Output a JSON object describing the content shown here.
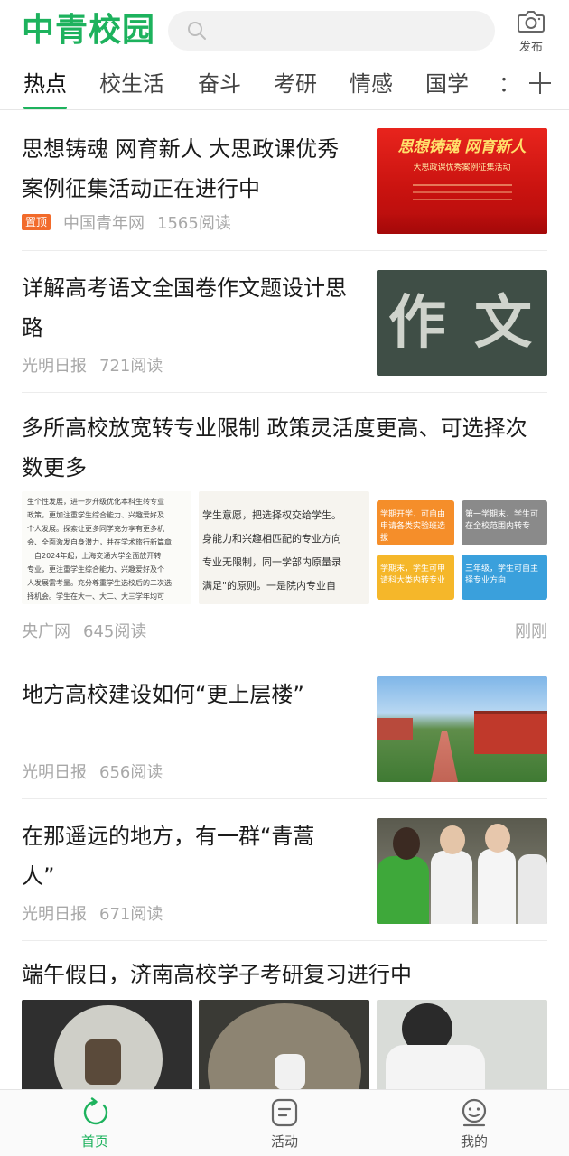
{
  "header": {
    "logo": "中青校园",
    "search_placeholder": "",
    "publish_label": "发布"
  },
  "tabs": [
    {
      "label": "热点",
      "active": true
    },
    {
      "label": "校生活"
    },
    {
      "label": "奋斗"
    },
    {
      "label": "考研"
    },
    {
      "label": "情感"
    },
    {
      "label": "国学"
    }
  ],
  "tab_more": "：",
  "articles": [
    {
      "title": "思想铸魂 网育新人 大思政课优秀案例征集活动正在进行中",
      "badge": "置顶",
      "source": "中国青年网",
      "reads": "1565阅读",
      "image_text": {
        "line1": "思想铸魂  网育新人",
        "line2": "大思政课优秀案例征集活动"
      }
    },
    {
      "title": "详解高考语文全国卷作文题设计思路",
      "source": "光明日报",
      "reads": "721阅读",
      "image_text": {
        "char1": "作",
        "char2": "文"
      }
    },
    {
      "title": "多所高校放宽转专业限制 政策灵活度更高、可选择次数更多",
      "source": "央广网",
      "reads": "645阅读",
      "time": "刚刚",
      "image_text": {
        "doc_lines": [
          "生个性发展，进一步升级优化本科生转专业",
          "政策，更加注重学生综合能力、兴趣爱好及",
          "个人发展。探索让更多同学充分享有更多机",
          "会、全面激发自身潜力，并在学术旅行新篇章",
          "　自2024年起，上海交通大学全面放开转",
          "专业，更注重学生综合能力、兴趣爱好及个",
          "人发展需考量。充分尊重学生选校后的二次选",
          "择机会。学生在大一、大二、大三学年均可"
        ],
        "mid_lines": [
          "学生意愿，把选择权交给学生。",
          "身能力和兴趣相匹配的专业方向",
          "专业无限制，同一学部内原量录",
          "满足\"的原则。一是院内专业自"
        ],
        "box1": "学期开学，可自由申请各类实验班选拔",
        "box2": "第一学期末，学生可在全校范围内转专",
        "box3": "学期末，学生可申请科大类内转专业",
        "box4": "三年级，学生可自主择专业方向"
      }
    },
    {
      "title": "地方高校建设如何“更上层楼”",
      "source": "光明日报",
      "reads": "656阅读"
    },
    {
      "title": "在那遥远的地方，有一群“青蒿人”",
      "source": "光明日报",
      "reads": "671阅读"
    },
    {
      "title": "端午假日，济南高校学子考研复习进行中"
    }
  ],
  "bottom_nav": [
    {
      "label": "首页",
      "active": true
    },
    {
      "label": "活动"
    },
    {
      "label": "我的"
    }
  ],
  "colors": {
    "accent": "#1db25d",
    "pin_badge": "#f26b2b",
    "meta_gray": "#a8a8a8",
    "divider": "#ececec"
  },
  "icons": {
    "search": "search-icon",
    "publish": "camera-icon",
    "tab_add": "plus-icon",
    "home": "refresh-home-icon",
    "activity": "activity-doc-icon",
    "profile": "smiley-profile-icon"
  }
}
